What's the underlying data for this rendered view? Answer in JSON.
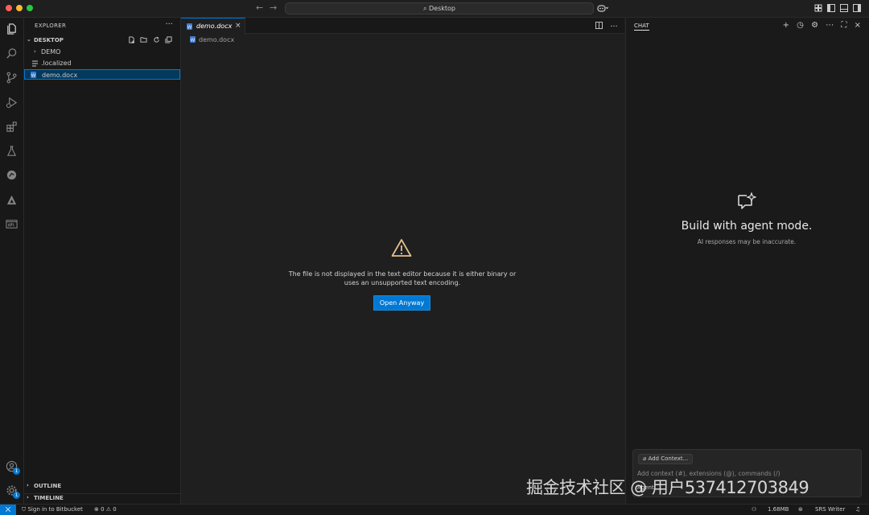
{
  "titlebar": {
    "search_text": "Desktop",
    "back_arrow": "←",
    "forward_arrow": "→",
    "search_glyph": "⌕"
  },
  "explorer": {
    "title": "EXPLORER",
    "more": "···",
    "section": "DESKTOP",
    "items": [
      {
        "label": "DEMO",
        "type": "folder"
      },
      {
        "label": ".localized",
        "type": "file"
      },
      {
        "label": "demo.docx",
        "type": "docx",
        "selected": true
      }
    ],
    "outline": "OUTLINE",
    "timeline": "TIMELINE"
  },
  "editor": {
    "tab_label": "demo.docx",
    "tab_close": "×",
    "breadcrumb": "demo.docx",
    "message": "The file is not displayed in the text editor because it is either binary or uses an unsupported text encoding.",
    "open_button": "Open Anyway"
  },
  "chat": {
    "tab": "CHAT",
    "title": "Build with agent mode.",
    "subtitle": "AI responses may be inaccurate.",
    "add_context": "Add Context...",
    "placeholder": "Add context (#), extensions (@), commands (/)",
    "mode": "Agent"
  },
  "statusbar": {
    "remote": "⨉",
    "bitbucket": "Sign in to Bitbucket",
    "problems": "⊗ 0 ⚠ 0",
    "memory": "1.68MB",
    "srs": "SRS Writer"
  },
  "activity": {
    "accounts_badge": "1",
    "manage_badge": "1"
  },
  "watermark": "掘金技术社区 @ 用户537412703849",
  "colors": {
    "accent": "#0078d4",
    "warning": "#e2c08d",
    "background": "#1f1f1f",
    "sidebar": "#181818"
  }
}
